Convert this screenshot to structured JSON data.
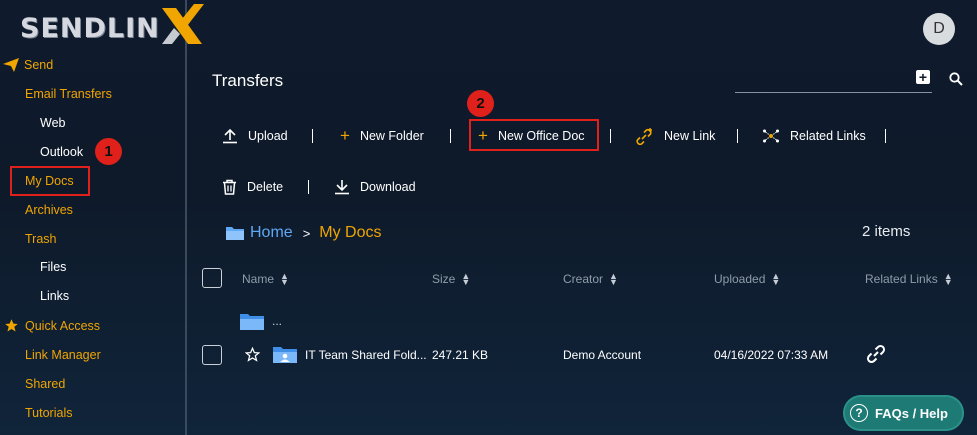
{
  "brand": {
    "logo_text": "SENDLIN",
    "logo_x": "X"
  },
  "user": {
    "avatar_initial": "D"
  },
  "sidebar": {
    "send": "Send",
    "email_transfers": "Email Transfers",
    "web": "Web",
    "outlook": "Outlook",
    "my_docs": "My Docs",
    "archives": "Archives",
    "trash": "Trash",
    "files": "Files",
    "links": "Links",
    "quick_access": "Quick Access",
    "link_manager": "Link Manager",
    "shared": "Shared",
    "tutorials": "Tutorials"
  },
  "annotations": {
    "badge_1": "1",
    "badge_2": "2"
  },
  "header": {
    "title": "Transfers"
  },
  "toolbar": {
    "upload": "Upload",
    "new_folder": "New Folder",
    "new_office_doc": "New Office Doc",
    "new_link": "New Link",
    "related_links": "Related Links",
    "delete": "Delete",
    "download": "Download"
  },
  "breadcrumb": {
    "home": "Home",
    "separator": ">",
    "current": "My Docs"
  },
  "items_count": "2 items",
  "table": {
    "columns": {
      "name": "Name",
      "size": "Size",
      "creator": "Creator",
      "uploaded": "Uploaded",
      "related_links": "Related Links"
    },
    "parent_row": {
      "label": "..."
    },
    "rows": [
      {
        "name": "IT Team Shared Fold...",
        "size": "247.21 KB",
        "creator": "Demo Account",
        "uploaded": "04/16/2022 07:33 AM"
      }
    ]
  },
  "help": {
    "label": "FAQs / Help"
  },
  "colors": {
    "accent": "#f0a500",
    "highlight": "#e0201a",
    "link_blue": "#5fa8f5",
    "help_bg": "#1e7a74"
  }
}
